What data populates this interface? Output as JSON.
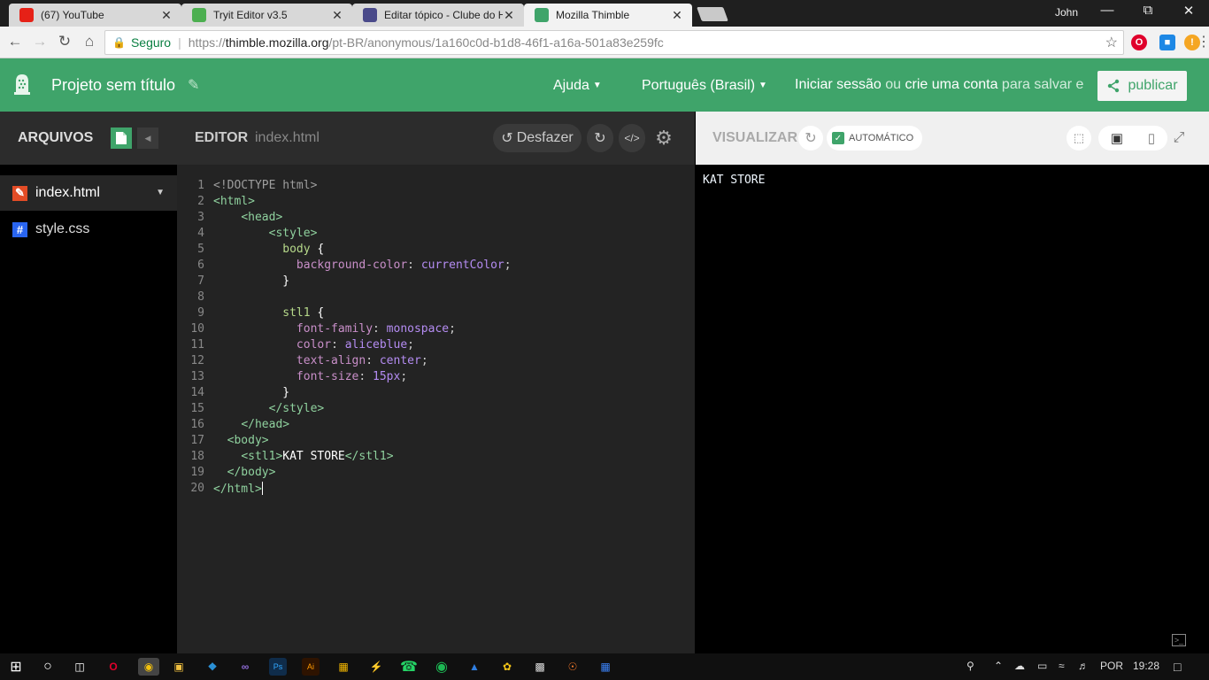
{
  "browser": {
    "tabs": [
      {
        "title": "(67) YouTube",
        "favicon": "youtube-icon",
        "color": "#e62117",
        "active": false
      },
      {
        "title": "Tryit Editor v3.5",
        "favicon": "w3schools-icon",
        "color": "#4caf50",
        "active": false
      },
      {
        "title": "Editar tópico - Clube do H",
        "favicon": "clube-do-hardware-icon",
        "color": "#4a4a8a",
        "active": false
      },
      {
        "title": "Mozilla Thimble",
        "favicon": "thimble-icon",
        "color": "#3fa46a",
        "active": true
      }
    ],
    "user": "John",
    "address": {
      "secure_label": "Seguro",
      "url_scheme": "https://",
      "url_host": "thimble.mozilla.org",
      "url_path": "/pt-BR/anonymous/1a160c0d-b1d8-46f1-a16a-501a83e259fc"
    }
  },
  "thimble": {
    "project_title": "Projeto sem título",
    "help": "Ajuda",
    "language": "Português (Brasil)",
    "signin": "Iniciar sessão",
    "or": "ou",
    "create_account": "crie uma conta",
    "to_save": "para salvar e",
    "publish": "publicar",
    "accent": "#3fa46a"
  },
  "sidebar": {
    "title": "ARQUIVOS",
    "files": [
      {
        "name": "index.html",
        "icon": "html-file-icon",
        "selected": true
      },
      {
        "name": "style.css",
        "icon": "css-file-icon",
        "selected": false
      }
    ]
  },
  "editor": {
    "title": "EDITOR",
    "filename": "index.html",
    "undo": "Desfazer",
    "lines": [
      "<!DOCTYPE html>",
      "<html>",
      "    <head>",
      "        <style>",
      "          body {",
      "            background-color: currentColor;",
      "          }",
      "",
      "          stl1 {",
      "            font-family: monospace;",
      "            color: aliceblue;",
      "            text-align: center;",
      "            font-size: 15px;",
      "          }",
      "        </style>",
      "    </head>",
      "  <body>",
      "    <stl1>KAT STORE</stl1>",
      "  </body>",
      "</html>"
    ]
  },
  "preview": {
    "title": "VISUALIZAR",
    "auto": "AUTOMÁTICO",
    "output": "KAT STORE"
  },
  "taskbar": {
    "lang": "POR",
    "time": "19:28"
  }
}
